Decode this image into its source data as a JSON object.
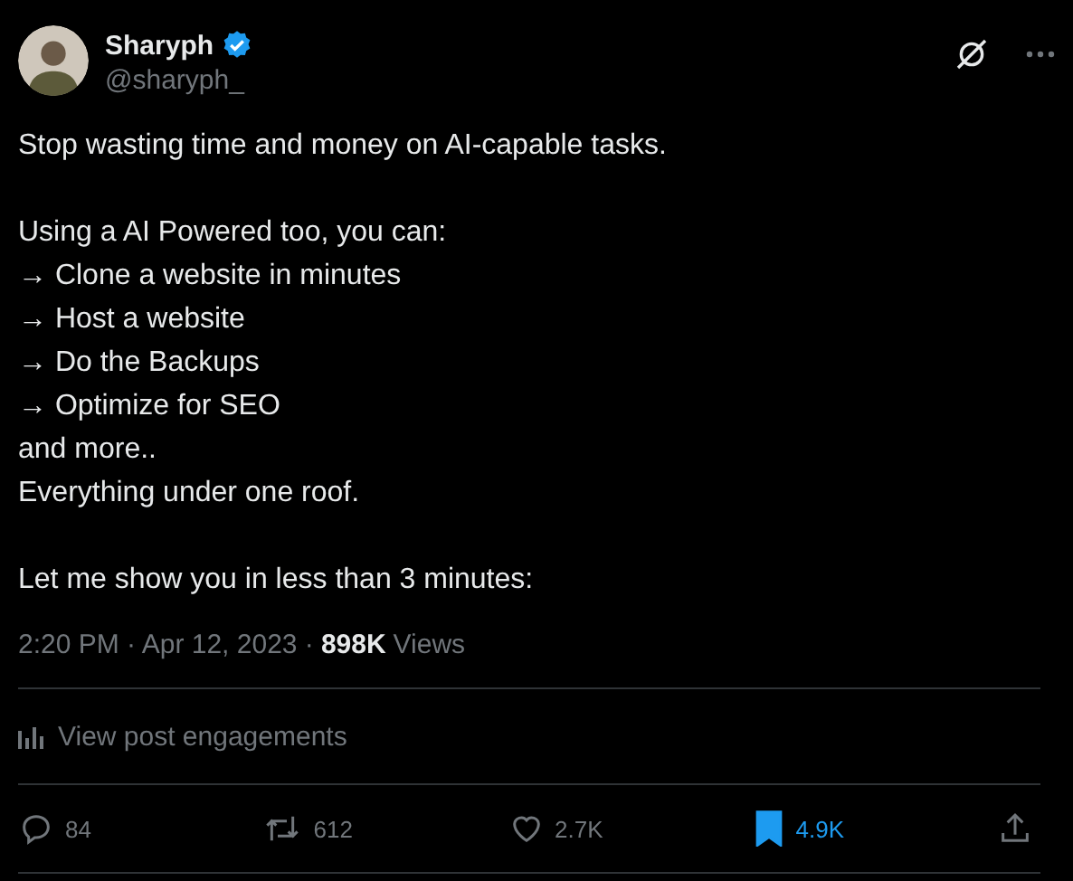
{
  "author": {
    "name": "Sharyph",
    "verified": true,
    "handle": "@sharyph_"
  },
  "body": [
    [
      "Stop wasting time and money on AI-capable tasks."
    ],
    [
      "Using a AI Powered too, you can:",
      "→ Clone a website in minutes",
      "→ Host a website",
      "→ Do the Backups",
      "→ Optimize for SEO",
      "and more..",
      "Everything under one roof."
    ],
    [
      "Let me show you in less than 3 minutes:"
    ]
  ],
  "meta": {
    "timestamp": "2:20 PM · Apr 12, 2023 ·",
    "views_count": "898K",
    "views_label": "Views"
  },
  "engagements_link": "View post engagements",
  "actions": [
    {
      "kind": "reply",
      "count": "84",
      "active": false
    },
    {
      "kind": "repost",
      "count": "612",
      "active": false
    },
    {
      "kind": "like",
      "count": "2.7K",
      "active": false
    },
    {
      "kind": "bookmark",
      "count": "4.9K",
      "active": true
    },
    {
      "kind": "share",
      "active": false
    }
  ]
}
